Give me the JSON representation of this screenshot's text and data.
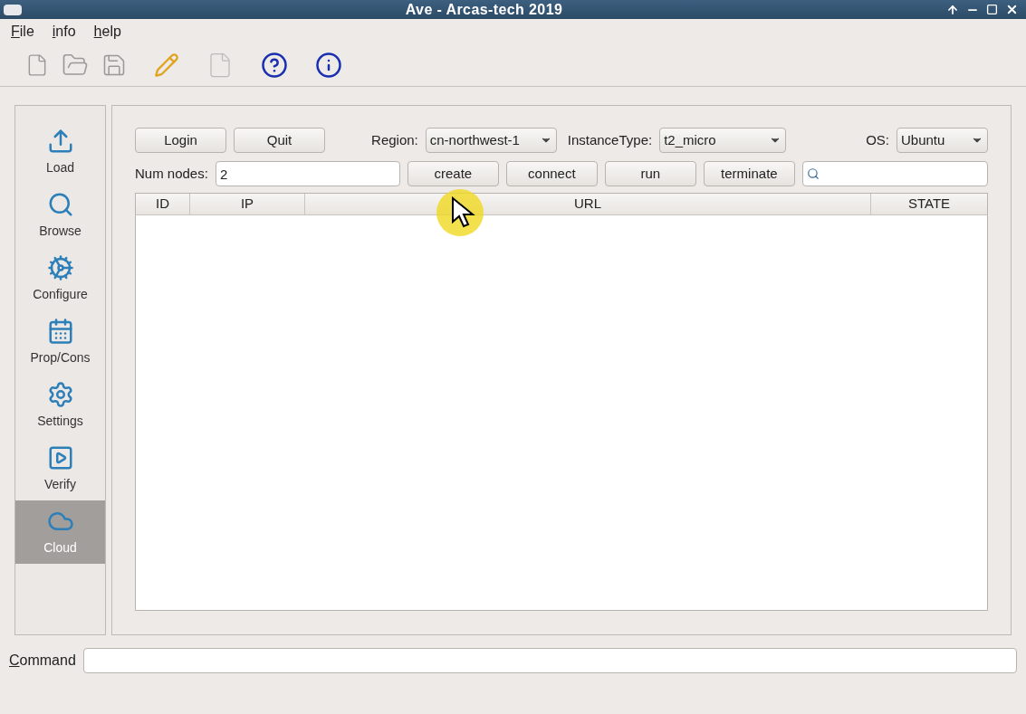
{
  "window": {
    "title": "Ave - Arcas-tech 2019"
  },
  "menu": [
    "File",
    "info",
    "help"
  ],
  "sidebar": {
    "items": [
      {
        "label": "Load",
        "kind": "load",
        "selected": false
      },
      {
        "label": "Browse",
        "kind": "browse",
        "selected": false
      },
      {
        "label": "Configure",
        "kind": "configure",
        "selected": false
      },
      {
        "label": "Prop/Cons",
        "kind": "calendar",
        "selected": false
      },
      {
        "label": "Settings",
        "kind": "settings",
        "selected": false
      },
      {
        "label": "Verify",
        "kind": "verify",
        "selected": false
      },
      {
        "label": "Cloud",
        "kind": "cloud",
        "selected": true
      }
    ]
  },
  "top_buttons": [
    "Login",
    "Quit"
  ],
  "region": {
    "label": "Region:",
    "value": "cn-northwest-1"
  },
  "instance_type": {
    "label": "InstanceType:",
    "value": "t2_micro"
  },
  "os": {
    "label": "OS:",
    "value": "Ubuntu"
  },
  "num_nodes": {
    "label": "Num nodes:",
    "value": "2"
  },
  "action_buttons": [
    "create",
    "connect",
    "run",
    "terminate"
  ],
  "table": {
    "columns": [
      "ID",
      "IP",
      "URL",
      "STATE"
    ]
  },
  "command": {
    "label": "Command"
  }
}
